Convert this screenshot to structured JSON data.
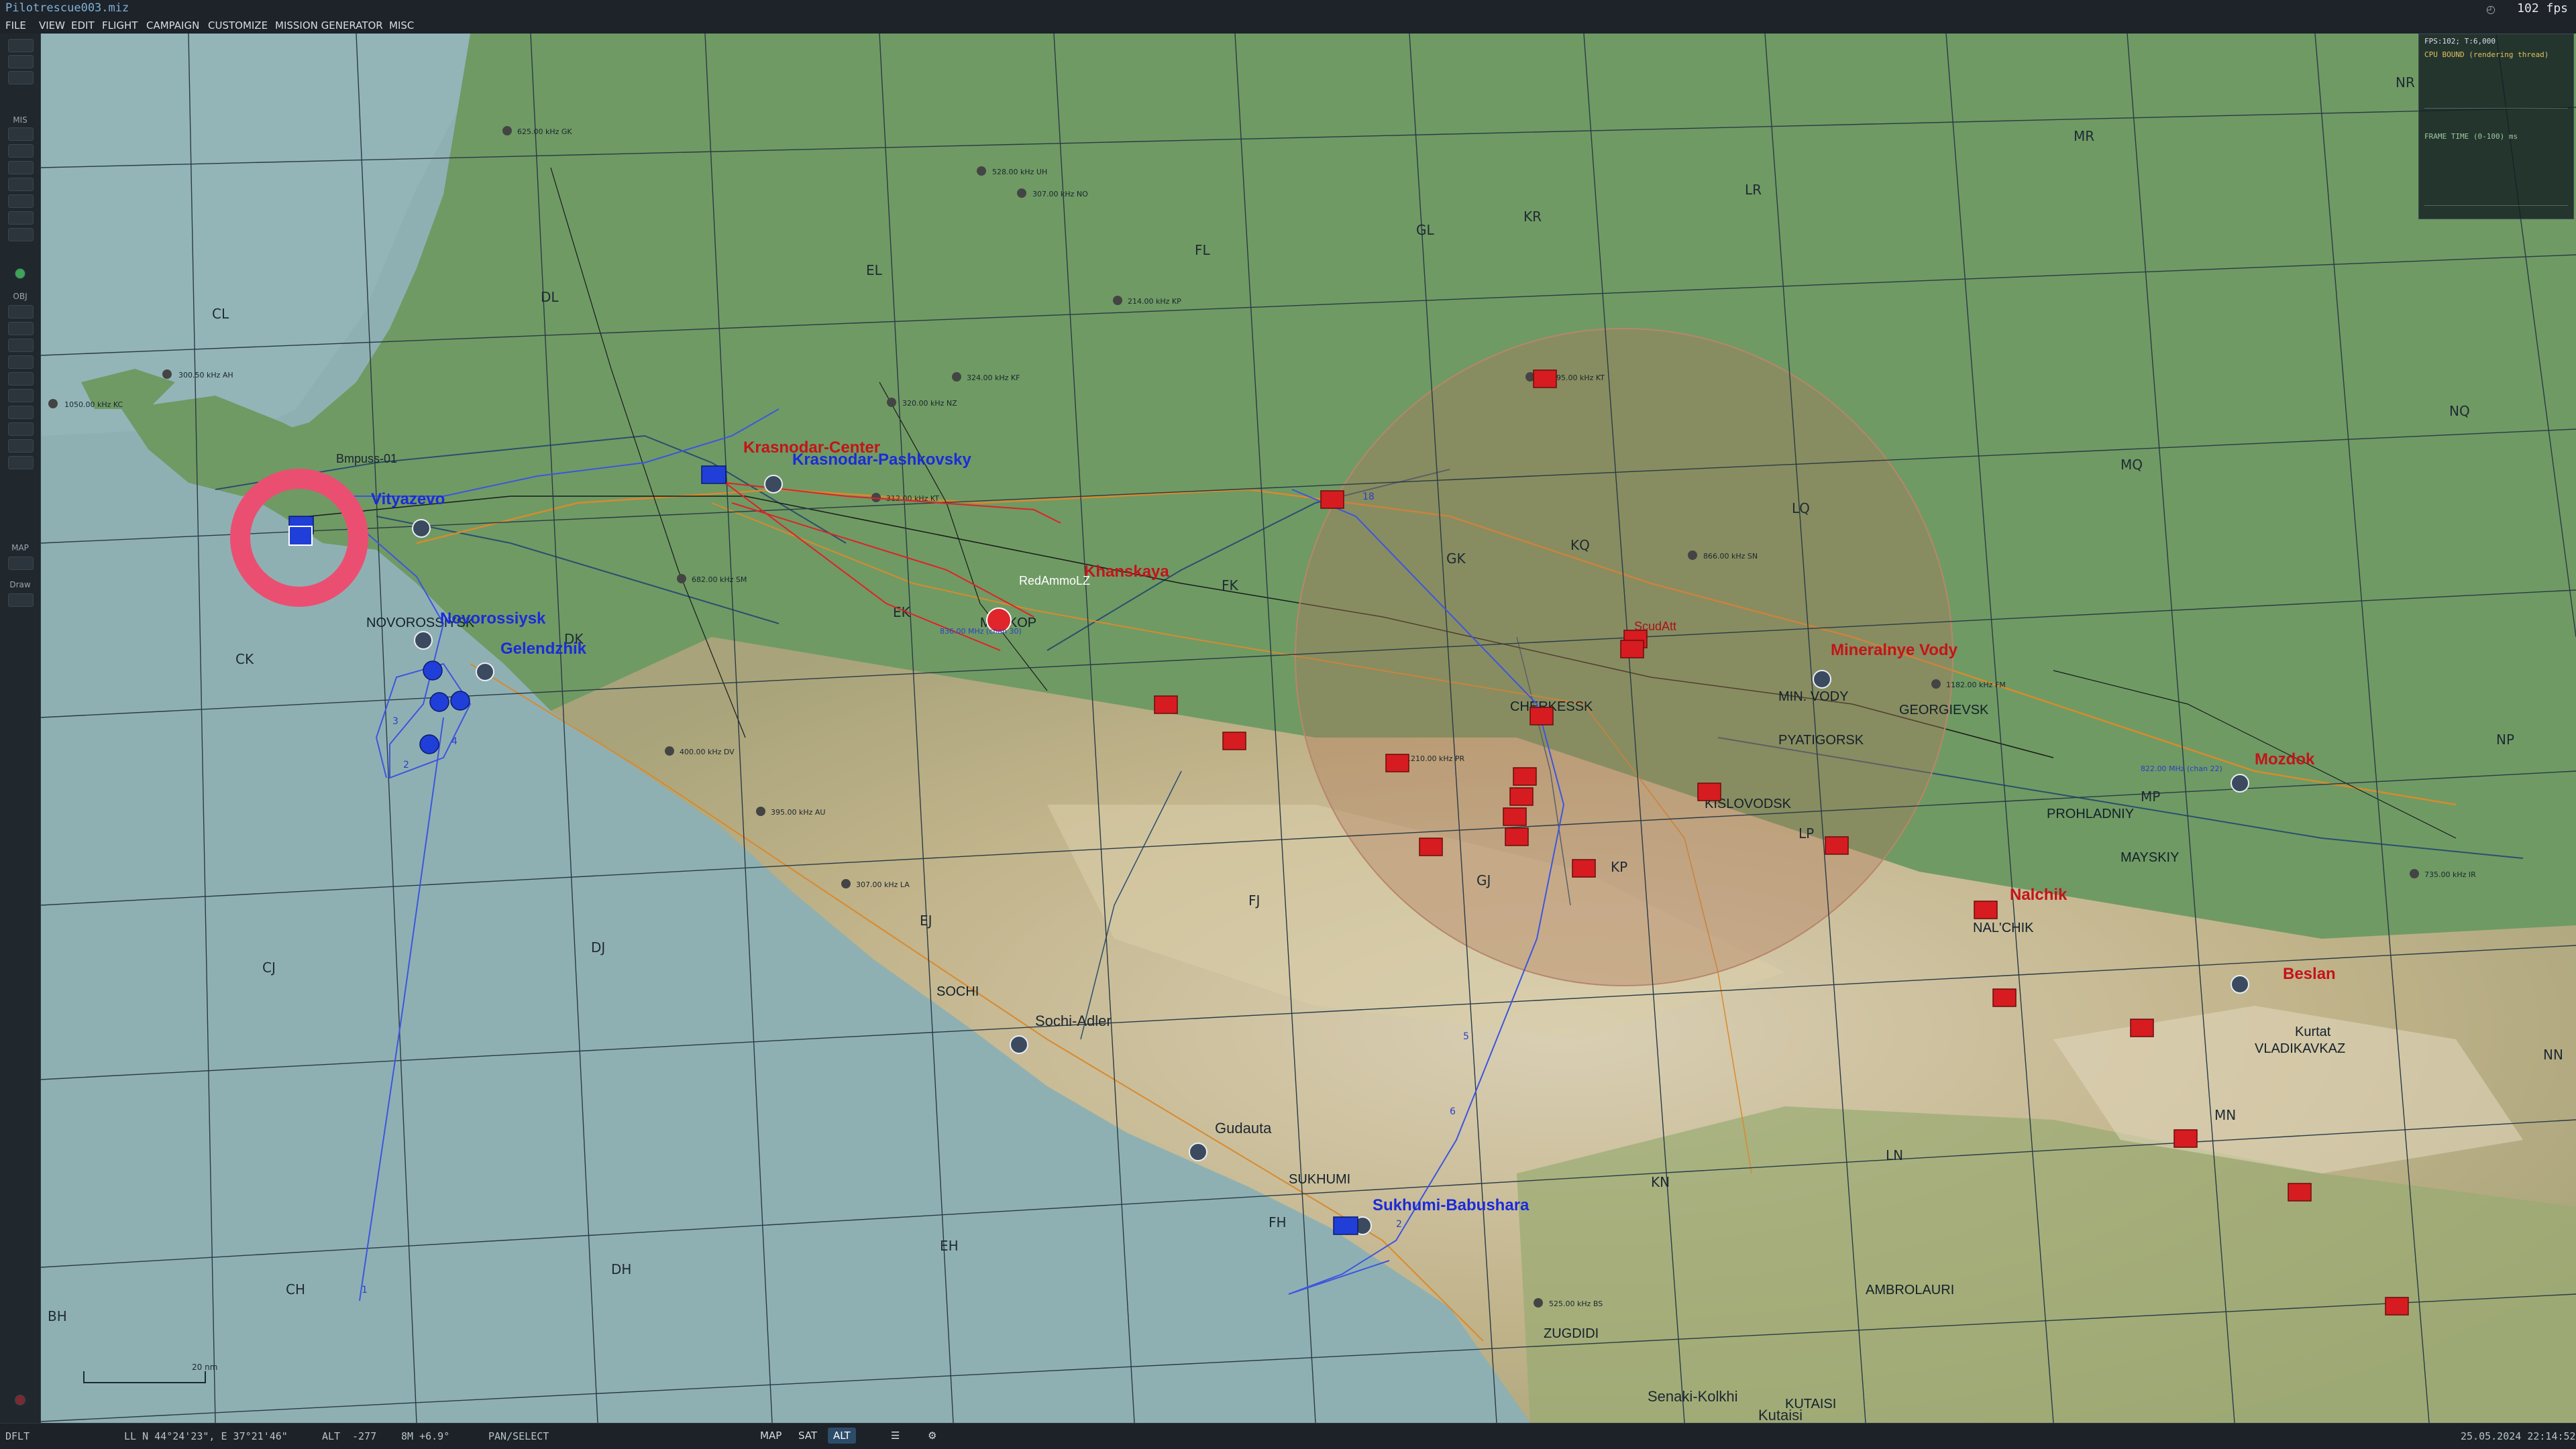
{
  "window": {
    "title": "Pilotrescue003.miz",
    "fps": "102 fps"
  },
  "menu": [
    "FILE",
    "VIEW",
    "EDIT",
    "FLIGHT",
    "CAMPAIGN",
    "CUSTOMIZE",
    "MISSION GENERATOR",
    "MISC"
  ],
  "toolbar": {
    "sections": [
      "MIS",
      "OBJ",
      "MAP",
      "Draw"
    ]
  },
  "stats_panel": {
    "header": "FPS:102; T:6,000",
    "line1": "CPU BOUND (rendering thread)",
    "line2": "FRAME TIME (0-100) ms"
  },
  "map": {
    "grid_labels": [
      "CL",
      "DL",
      "EL",
      "FL",
      "GL",
      "KR",
      "LR",
      "MR",
      "NR",
      "NQ",
      "MQ",
      "LQ",
      "KQ",
      "GK",
      "FK",
      "EK",
      "DK",
      "CK",
      "CJ",
      "DJ",
      "EJ",
      "FJ",
      "GJ",
      "KP",
      "LP",
      "MP",
      "NP",
      "MN",
      "LN",
      "KN",
      "CH",
      "DH",
      "EH",
      "FH",
      "BH",
      "NN"
    ],
    "towns": [
      "NOVOROSSIYSK",
      "MAYKOP",
      "CHERKESSK",
      "PYATIGORSK",
      "KISLOVODSK",
      "NAL'CHIK",
      "PROHLADNIY",
      "MAYSKIY",
      "GEORGIEVSK",
      "Kurtat",
      "VLADIKAVKAZ",
      "SOCHI",
      "SUKHUMI",
      "ZUGDIDI",
      "AMBROLAURI",
      "KUTAISI",
      "MIN. VODY"
    ],
    "airbases_blue": [
      "Vityazevo",
      "Novorossiysk",
      "Gelendzhik",
      "Krasnodar-Pashkovsky",
      "Sukhumi-Babushara",
      "Sochi-Adler",
      "Gudauta"
    ],
    "airbases_red": [
      "Krasnodar-Center",
      "Khanskaya",
      "Mineralnye Vody",
      "Mozdok",
      "Nalchik",
      "Beslan"
    ],
    "airbases_dark": [
      "Senaki-Kolkhi",
      "Kutaisi"
    ],
    "markers": [
      "Bmpuss-01",
      "RedAmmoLZ",
      "ScudAtt"
    ],
    "scale_label": "20 nm",
    "nav_freqs": [
      "625.00 kHz GK",
      "528.00 kHz UH",
      "307.00 kHz NO",
      "214.00 kHz KP",
      "300.50 kHz AH",
      "1050.00 kHz KC",
      "320.00 kHz NZ",
      "324.00 kHz KF",
      "312.00 kHz KT",
      "682.00 kHz SM",
      "400.00 kHz DV",
      "395.00 kHz AU",
      "307.00 kHz LA",
      "866.00 kHz SN",
      "995.00 kHz KT",
      "1210.00 kHz PR",
      "1182.00 kHz FM",
      "735.00 kHz IR",
      "525.00 kHz BS",
      "836.00 MHz (chan 30)",
      "822.00 MHz (chan 22)"
    ]
  },
  "status": {
    "mode": "DFLT",
    "coords": "LL N 44°24'23\", E 37°21'46\"",
    "alt_label": "ALT",
    "alt": "-277",
    "bearing": "8M +6.9°",
    "tool": "PAN/SELECT",
    "map_btn": "MAP",
    "sat_btn": "SAT",
    "alt_btn": "ALT",
    "datetime": "25.05.2024 22:14:52"
  },
  "colors": {
    "sea": "#8fb0b3",
    "land_low": "#6f9a64",
    "land_hill": "#b9ac83",
    "threat_zone": "#b07a5a",
    "blue_coalition": "#1b2bd9",
    "red_coalition": "#d01c1f",
    "selection_ring": "#ea4f72"
  }
}
